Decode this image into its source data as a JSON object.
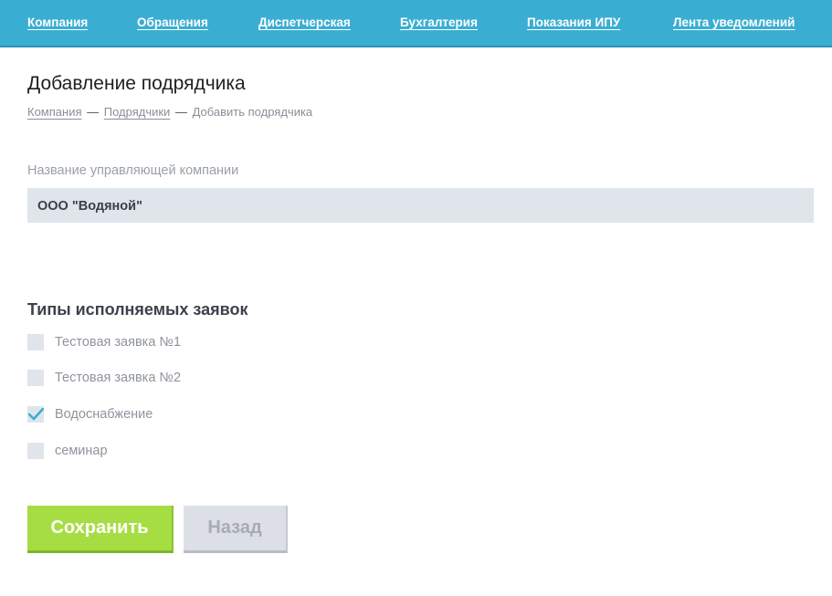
{
  "nav": {
    "items": [
      {
        "label": "Компания"
      },
      {
        "label": "Обращения"
      },
      {
        "label": "Диспетчерская"
      },
      {
        "label": "Бухгалтерия"
      },
      {
        "label": "Показания ИПУ"
      },
      {
        "label": "Лента уведомлений"
      }
    ]
  },
  "page": {
    "title": "Добавление подрядчика"
  },
  "breadcrumb": {
    "items": [
      {
        "label": "Компания"
      },
      {
        "label": "Подрядчики"
      },
      {
        "label": "Добавить подрядчика"
      }
    ],
    "separator": "—"
  },
  "company": {
    "label": "Название управляющей компании",
    "value": "ООО \"Водяной\""
  },
  "request_types": {
    "title": "Типы исполняемых заявок",
    "items": [
      {
        "label": "Тестовая заявка №1",
        "checked": false
      },
      {
        "label": "Тестовая заявка №2",
        "checked": false
      },
      {
        "label": "Водоснабжение",
        "checked": true
      },
      {
        "label": "семинар",
        "checked": false
      }
    ]
  },
  "actions": {
    "save_label": "Сохранить",
    "back_label": "Назад"
  },
  "colors": {
    "nav_bg": "#3aaed2",
    "save_button": "#a6dd43",
    "back_button": "#dcdfe6",
    "check_mark": "#3aaed2"
  }
}
